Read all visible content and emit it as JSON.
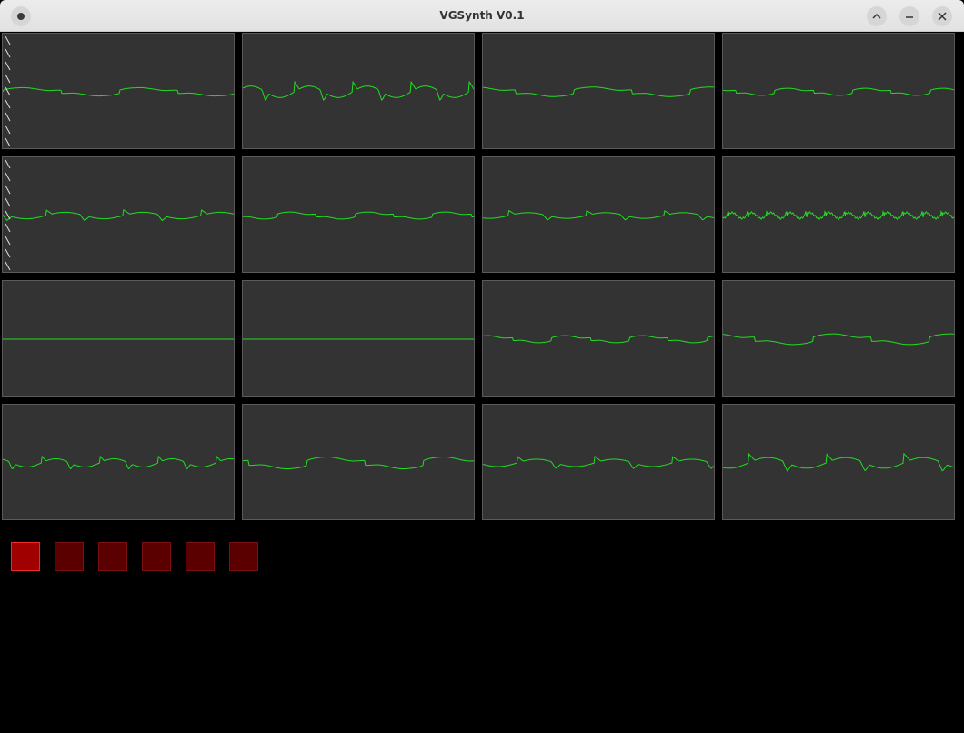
{
  "window": {
    "title": "VGSynth V0.1"
  },
  "titlebar": {
    "menu_icon": "dot-menu-icon",
    "buttons": [
      "chevron-up-icon",
      "minimize-icon",
      "close-icon"
    ]
  },
  "colors": {
    "waveform": "#22dd22",
    "panel_bg": "#333333",
    "pad_active": "#a10000",
    "pad_inactive": "#5a0000"
  },
  "waveforms": [
    {
      "cycles": 2,
      "amp": 7,
      "kind": "smooth"
    },
    {
      "cycles": 4,
      "amp": 14,
      "kind": "spiky"
    },
    {
      "cycles": 2,
      "amp": 8,
      "kind": "smooth"
    },
    {
      "cycles": 3,
      "amp": 6,
      "kind": "smooth"
    },
    {
      "cycles": 3,
      "amp": 8,
      "kind": "spiky"
    },
    {
      "cycles": 3,
      "amp": 6,
      "kind": "smooth"
    },
    {
      "cycles": 3,
      "amp": 7,
      "kind": "spiky"
    },
    {
      "cycles": 12,
      "amp": 8,
      "kind": "noisy"
    },
    {
      "cycles": 0,
      "amp": 0,
      "kind": "flat"
    },
    {
      "cycles": 0,
      "amp": 0,
      "kind": "flat"
    },
    {
      "cycles": 3,
      "amp": 6,
      "kind": "smooth"
    },
    {
      "cycles": 2,
      "amp": 9,
      "kind": "smooth"
    },
    {
      "cycles": 4,
      "amp": 10,
      "kind": "spiky"
    },
    {
      "cycles": 2,
      "amp": 10,
      "kind": "smooth"
    },
    {
      "cycles": 3,
      "amp": 9,
      "kind": "spiky"
    },
    {
      "cycles": 3,
      "amp": 13,
      "kind": "spiky"
    }
  ],
  "pads": [
    {
      "active": true
    },
    {
      "active": false
    },
    {
      "active": false
    },
    {
      "active": false
    },
    {
      "active": false
    },
    {
      "active": false
    }
  ]
}
